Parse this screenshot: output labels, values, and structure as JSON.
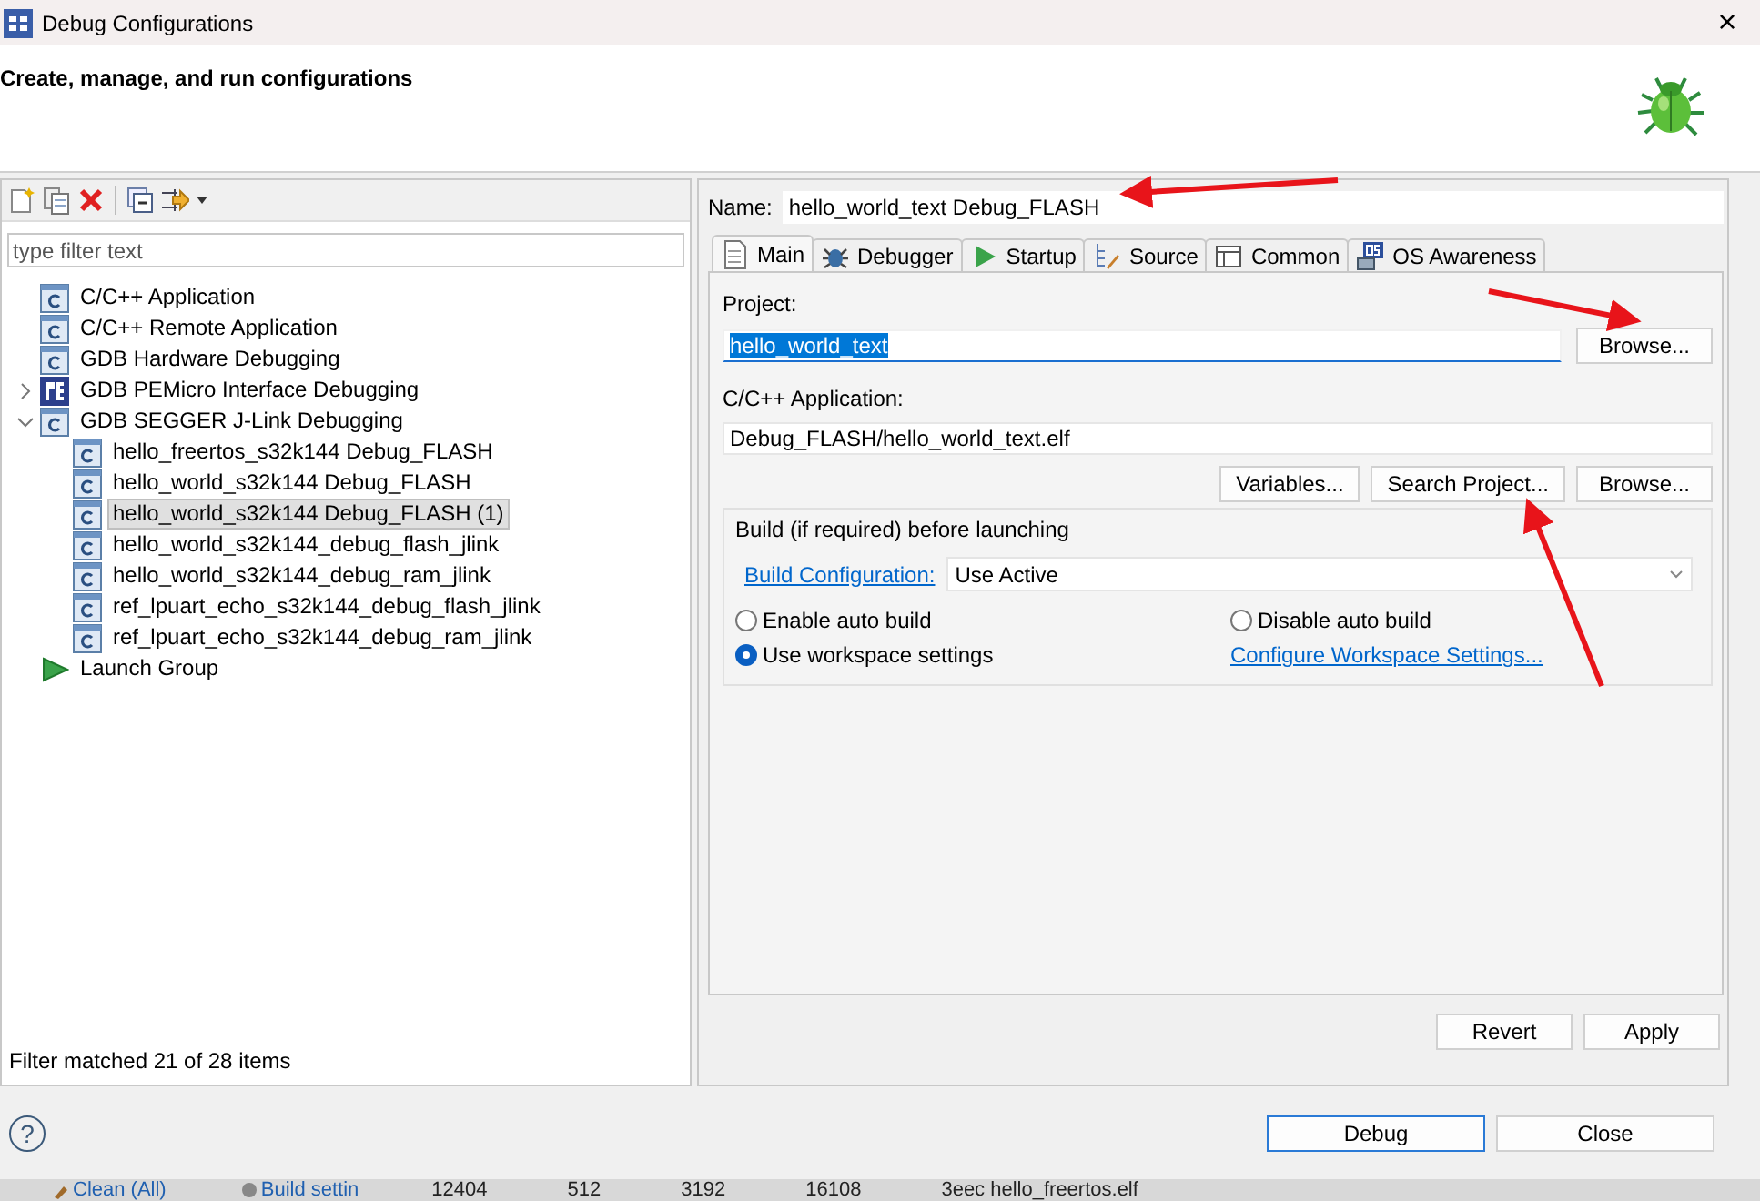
{
  "window": {
    "title": "Debug Configurations",
    "close": "×"
  },
  "header": {
    "title": "Create, manage, and run configurations"
  },
  "sidebar": {
    "filter": {
      "placeholder": "type filter text"
    },
    "tree": [
      {
        "label": "C/C++ Application",
        "kind": "c",
        "selected": false
      },
      {
        "label": "C/C++ Remote Application",
        "kind": "c",
        "selected": false
      },
      {
        "label": "GDB Hardware Debugging",
        "kind": "c",
        "selected": false
      },
      {
        "label": "GDB PEMicro Interface Debugging",
        "kind": "pe",
        "selected": false,
        "expanded": false
      },
      {
        "label": "GDB SEGGER J-Link Debugging",
        "kind": "c",
        "selected": false,
        "expanded": true,
        "children": [
          {
            "label": "hello_freertos_s32k144 Debug_FLASH",
            "kind": "c",
            "selected": false
          },
          {
            "label": "hello_world_s32k144 Debug_FLASH",
            "kind": "c",
            "selected": false
          },
          {
            "label": "hello_world_s32k144 Debug_FLASH (1)",
            "kind": "c",
            "selected": true
          },
          {
            "label": "hello_world_s32k144_debug_flash_jlink",
            "kind": "c",
            "selected": false
          },
          {
            "label": "hello_world_s32k144_debug_ram_jlink",
            "kind": "c",
            "selected": false
          },
          {
            "label": "ref_lpuart_echo_s32k144_debug_flash_jlink",
            "kind": "c",
            "selected": false
          },
          {
            "label": "ref_lpuart_echo_s32k144_debug_ram_jlink",
            "kind": "c",
            "selected": false
          }
        ]
      },
      {
        "label": "Launch Group",
        "kind": "launch",
        "selected": false
      }
    ],
    "status": "Filter matched 21 of 28 items"
  },
  "editor": {
    "name_label": "Name:",
    "name": "hello_world_text Debug_FLASH",
    "tabs": [
      {
        "label": "Main",
        "selected": true
      },
      {
        "label": "Debugger",
        "selected": false
      },
      {
        "label": "Startup",
        "selected": false
      },
      {
        "label": "Source",
        "selected": false
      },
      {
        "label": "Common",
        "selected": false
      },
      {
        "label": "OS Awareness",
        "selected": false
      }
    ],
    "project_label": "Project:",
    "project": "hello_world_text",
    "project_text_selected": true,
    "project_browse": "Browse...",
    "app_label": "C/C++ Application:",
    "app": "Debug_FLASH/hello_world_text.elf",
    "app_buttons": [
      "Variables...",
      "Search Project...",
      "Browse..."
    ],
    "build": {
      "title": "Build (if required) before launching",
      "config_link": "Build Configuration:",
      "config_value": "Use Active",
      "options": [
        {
          "label": "Enable auto build",
          "kind": "radio",
          "selected": false
        },
        {
          "label": "Disable auto build",
          "kind": "radio",
          "selected": false
        },
        {
          "label": "Use workspace settings",
          "kind": "radio",
          "selected": true
        },
        {
          "label": "Configure Workspace Settings...",
          "kind": "link"
        }
      ]
    },
    "buttons": [
      "Revert",
      "Apply"
    ]
  },
  "footer": {
    "help": "?",
    "buttons": [
      {
        "label": "Debug",
        "default": true
      },
      {
        "label": "Close",
        "default": false
      }
    ]
  },
  "background_strip": [
    {
      "label": "Clean (All)",
      "kind": "link"
    },
    {
      "label": "Build settin",
      "kind": "link"
    },
    {
      "label": "12404",
      "kind": "text"
    },
    {
      "label": "512",
      "kind": "text"
    },
    {
      "label": "3192",
      "kind": "text"
    },
    {
      "label": "16108",
      "kind": "text"
    },
    {
      "label": "3eec hello_freertos.elf",
      "kind": "text"
    }
  ]
}
